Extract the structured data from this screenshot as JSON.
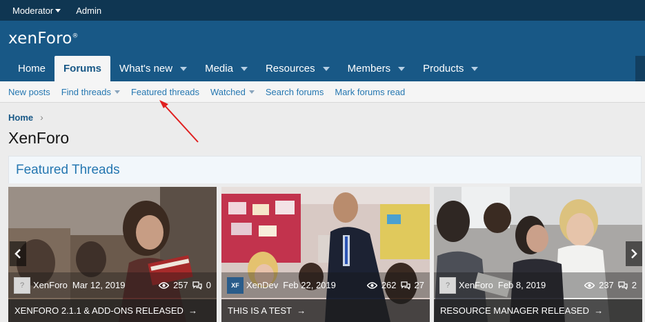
{
  "staff_bar": {
    "moderator": "Moderator",
    "admin": "Admin"
  },
  "header": {
    "logo_main": "xenForo",
    "logo_reg": "®"
  },
  "nav": {
    "tabs": [
      {
        "label": "Home",
        "dropdown": false
      },
      {
        "label": "Forums",
        "dropdown": false,
        "active": true
      },
      {
        "label": "What's new",
        "dropdown": true
      },
      {
        "label": "Media",
        "dropdown": true
      },
      {
        "label": "Resources",
        "dropdown": true
      },
      {
        "label": "Members",
        "dropdown": true
      },
      {
        "label": "Products",
        "dropdown": true
      }
    ]
  },
  "subnav": {
    "links": [
      {
        "label": "New posts",
        "dropdown": false
      },
      {
        "label": "Find threads",
        "dropdown": true
      },
      {
        "label": "Featured threads",
        "dropdown": false
      },
      {
        "label": "Watched",
        "dropdown": true
      },
      {
        "label": "Search forums",
        "dropdown": false
      },
      {
        "label": "Mark forums read",
        "dropdown": false
      }
    ]
  },
  "breadcrumb": {
    "home": "Home",
    "separator": "›"
  },
  "page_title": "XenForo",
  "featured": {
    "heading": "Featured Threads",
    "cards": [
      {
        "avatar": "?",
        "author": "XenForo",
        "date": "Mar 12, 2019",
        "views": "257",
        "replies": "0",
        "title": "XENFORO 2.1.1 & ADD-ONS RELEASED",
        "arrow": "→"
      },
      {
        "avatar": "XF",
        "author": "XenDev",
        "date": "Feb 22, 2019",
        "views": "262",
        "replies": "27",
        "title": "THIS IS A TEST",
        "arrow": "→"
      },
      {
        "avatar": "?",
        "author": "XenForo",
        "date": "Feb 8, 2019",
        "views": "237",
        "replies": "2",
        "title": "RESOURCE MANAGER RELEASED",
        "arrow": "→"
      }
    ]
  },
  "colors": {
    "staff_bar": "#0f3652",
    "header": "#185886",
    "link": "#2577b1",
    "annotation": "#e02020"
  }
}
